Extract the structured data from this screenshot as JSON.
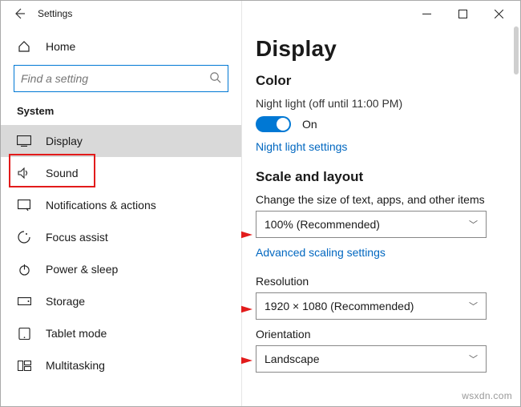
{
  "titlebar": {
    "title": "Settings"
  },
  "sidebar": {
    "home": "Home",
    "search_placeholder": "Find a setting",
    "group": "System",
    "items": [
      {
        "label": "Display"
      },
      {
        "label": "Sound"
      },
      {
        "label": "Notifications & actions"
      },
      {
        "label": "Focus assist"
      },
      {
        "label": "Power & sleep"
      },
      {
        "label": "Storage"
      },
      {
        "label": "Tablet mode"
      },
      {
        "label": "Multitasking"
      }
    ]
  },
  "content": {
    "title": "Display",
    "color": {
      "heading": "Color",
      "night_light_status": "Night light (off until 11:00 PM)",
      "toggle_label": "On",
      "link": "Night light settings"
    },
    "scale": {
      "heading": "Scale and layout",
      "size_label": "Change the size of text, apps, and other items",
      "size_value": "100% (Recommended)",
      "advanced_link": "Advanced scaling settings",
      "resolution_label": "Resolution",
      "resolution_value": "1920 × 1080 (Recommended)",
      "orientation_label": "Orientation",
      "orientation_value": "Landscape"
    }
  },
  "watermark": "wsxdn.com"
}
